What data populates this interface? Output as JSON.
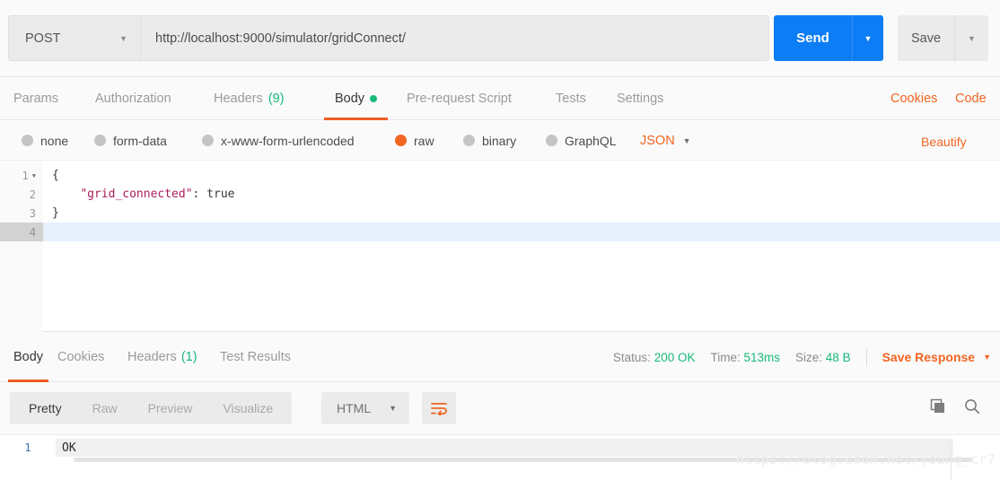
{
  "request": {
    "method": "POST",
    "url": "http://localhost:9000/simulator/gridConnect/",
    "send_label": "Send",
    "save_label": "Save",
    "tabs": [
      {
        "label": "Params",
        "badge": "",
        "active": false
      },
      {
        "label": "Authorization",
        "badge": "",
        "active": false
      },
      {
        "label": "Headers",
        "badge": "(9)",
        "active": false
      },
      {
        "label": "Body",
        "badge": "",
        "active": true
      },
      {
        "label": "Pre-request Script",
        "badge": "",
        "active": false
      },
      {
        "label": "Tests",
        "badge": "",
        "active": false
      },
      {
        "label": "Settings",
        "badge": "",
        "active": false
      }
    ],
    "cookies_link": "Cookies",
    "code_link": "Code",
    "body_types": [
      {
        "label": "none",
        "selected": false
      },
      {
        "label": "form-data",
        "selected": false
      },
      {
        "label": "x-www-form-urlencoded",
        "selected": false
      },
      {
        "label": "raw",
        "selected": true
      },
      {
        "label": "binary",
        "selected": false
      },
      {
        "label": "GraphQL",
        "selected": false
      }
    ],
    "raw_format": "JSON",
    "beautify_label": "Beautify",
    "editor_lines": [
      {
        "num": "1",
        "foldable": true,
        "text": "{",
        "active": false
      },
      {
        "num": "2",
        "foldable": false,
        "key": "\"grid_connected\"",
        "rest": ": true",
        "active": false
      },
      {
        "num": "3",
        "foldable": false,
        "text": "}",
        "active": false
      },
      {
        "num": "4",
        "foldable": false,
        "text": "",
        "active": true
      }
    ]
  },
  "response": {
    "tabs": [
      {
        "label": "Body",
        "badge": "",
        "active": true
      },
      {
        "label": "Cookies",
        "badge": "",
        "active": false
      },
      {
        "label": "Headers",
        "badge": "(1)",
        "active": false
      },
      {
        "label": "Test Results",
        "badge": "",
        "active": false
      }
    ],
    "status_label": "Status:",
    "status_value": "200 OK",
    "time_label": "Time:",
    "time_value": "513ms",
    "size_label": "Size:",
    "size_value": "48 B",
    "save_response_label": "Save Response",
    "view_modes": [
      {
        "label": "Pretty",
        "active": true
      },
      {
        "label": "Raw",
        "active": false
      },
      {
        "label": "Preview",
        "active": false
      },
      {
        "label": "Visualize",
        "active": false
      }
    ],
    "format": "HTML",
    "body_lines": [
      {
        "num": "1",
        "text": "OK"
      }
    ]
  },
  "icons": {
    "copy": "copy-icon",
    "search": "search-icon",
    "wrap": "word-wrap-icon"
  },
  "colors": {
    "accent_orange": "#f26522",
    "send_blue": "#0d7df5",
    "success_green": "#16b979",
    "json_key": "#a71d5d"
  },
  "watermark": "https://blog.csdn.net/young_cr7"
}
